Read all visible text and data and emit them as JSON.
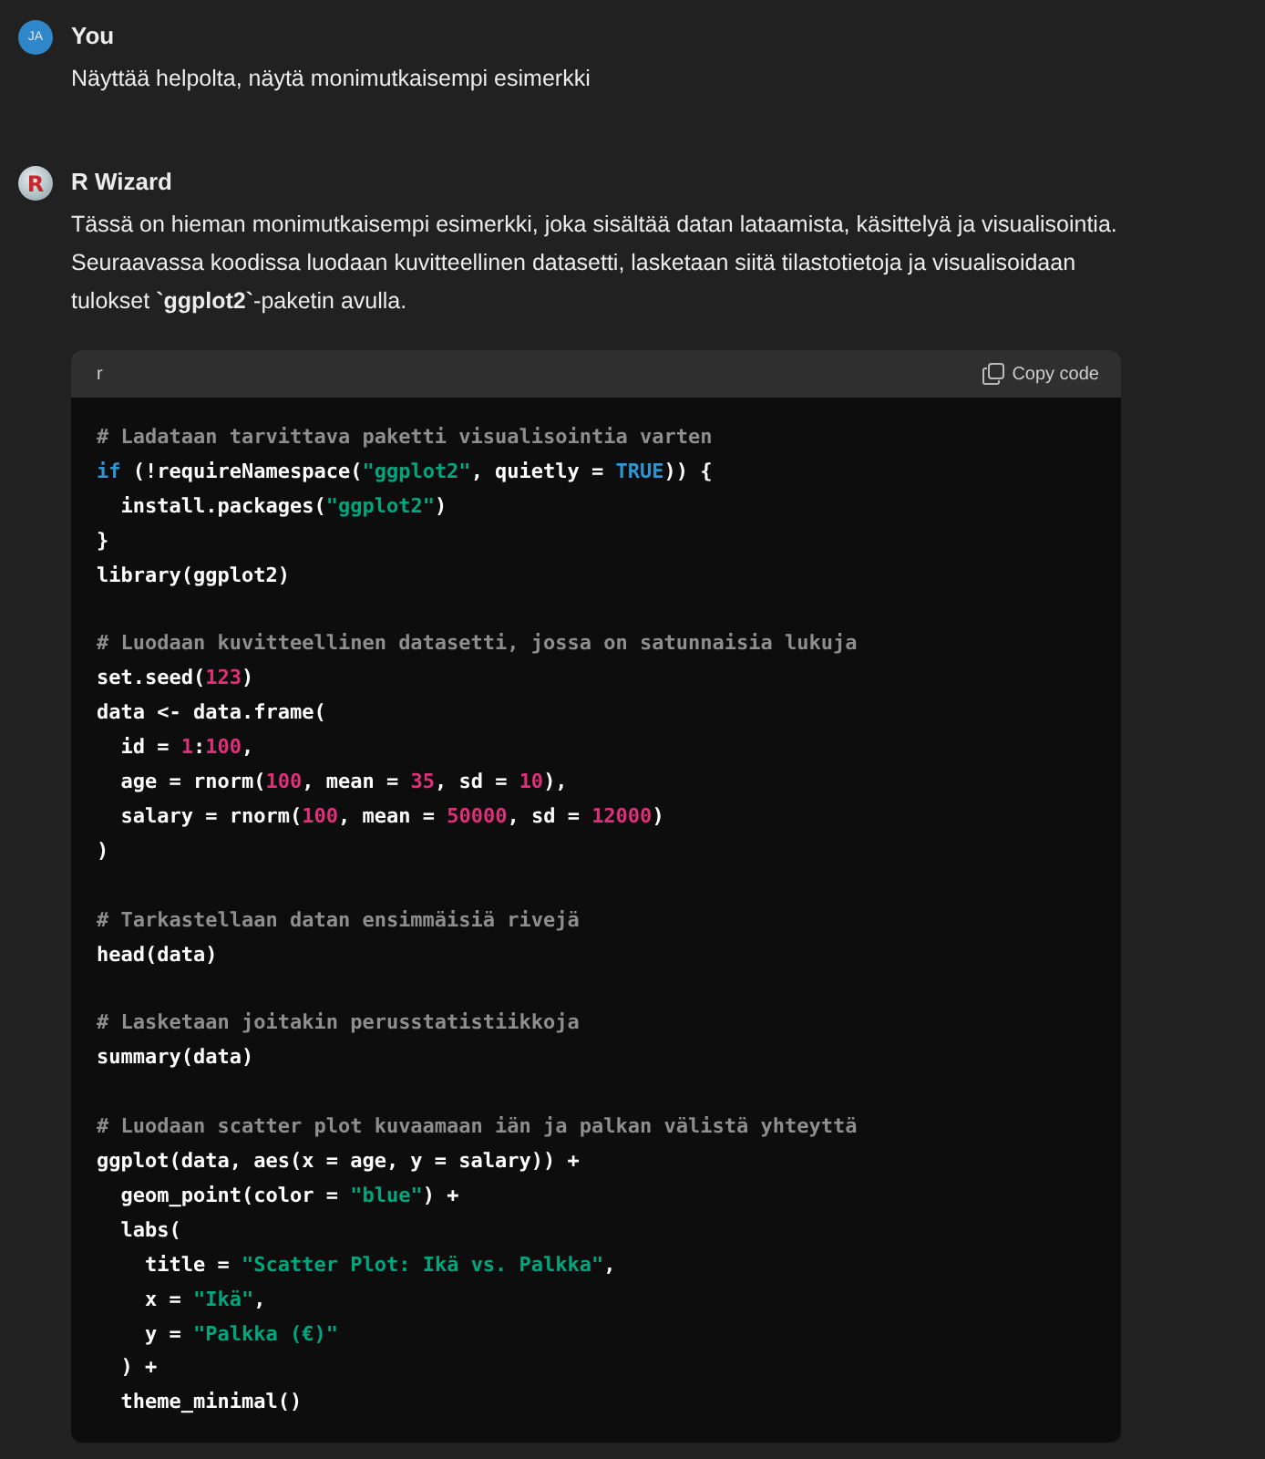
{
  "messages": [
    {
      "author": "You",
      "avatar": {
        "kind": "initials",
        "text": "JA"
      },
      "paragraphs": [
        "Näyttää helpolta, näytä monimutkaisempi esimerkki"
      ]
    },
    {
      "author": "R Wizard",
      "avatar": {
        "kind": "logo",
        "text": "R"
      },
      "paragraphs": [
        "Tässä on hieman monimutkaisempi esimerkki, joka sisältää datan lataamista, käsittelyä ja visualisointia. Seuraavassa koodissa luodaan kuvitteellinen datasetti, lasketaan siitä tilastotietoja ja visualisoidaan tulokset **`ggplot2`**-paketin avulla."
      ],
      "code": {
        "language": "r",
        "copy_label": "Copy code",
        "blocks": [
          [
            [
              {
                "text": "# Ladataan tarvittava paketti visualisointia varten",
                "kind": "comment"
              }
            ],
            [
              {
                "text": "if",
                "kind": "keyword"
              },
              {
                "text": " (!requireNamespace(",
                "kind": "plain"
              },
              {
                "text": "\"ggplot2\"",
                "kind": "string"
              },
              {
                "text": ", quietly = ",
                "kind": "plain"
              },
              {
                "text": "TRUE",
                "kind": "keyword"
              },
              {
                "text": ")) {",
                "kind": "plain"
              }
            ],
            [
              {
                "text": "  install.packages(",
                "kind": "plain"
              },
              {
                "text": "\"ggplot2\"",
                "kind": "string"
              },
              {
                "text": ")",
                "kind": "plain"
              }
            ],
            [
              {
                "text": "}",
                "kind": "plain"
              }
            ],
            [
              {
                "text": "library(ggplot2)",
                "kind": "plain"
              }
            ]
          ],
          [
            [
              {
                "text": "# Luodaan kuvitteellinen datasetti, jossa on satunnaisia lukuja",
                "kind": "comment"
              }
            ],
            [
              {
                "text": "set.seed(",
                "kind": "plain"
              },
              {
                "text": "123",
                "kind": "number"
              },
              {
                "text": ")",
                "kind": "plain"
              }
            ],
            [
              {
                "text": "data <- data.frame(",
                "kind": "plain"
              }
            ],
            [
              {
                "text": "  id = ",
                "kind": "plain"
              },
              {
                "text": "1",
                "kind": "number"
              },
              {
                "text": ":",
                "kind": "plain"
              },
              {
                "text": "100",
                "kind": "number"
              },
              {
                "text": ",",
                "kind": "plain"
              }
            ],
            [
              {
                "text": "  age = rnorm(",
                "kind": "plain"
              },
              {
                "text": "100",
                "kind": "number"
              },
              {
                "text": ", mean = ",
                "kind": "plain"
              },
              {
                "text": "35",
                "kind": "number"
              },
              {
                "text": ", sd = ",
                "kind": "plain"
              },
              {
                "text": "10",
                "kind": "number"
              },
              {
                "text": "),",
                "kind": "plain"
              }
            ],
            [
              {
                "text": "  salary = rnorm(",
                "kind": "plain"
              },
              {
                "text": "100",
                "kind": "number"
              },
              {
                "text": ", mean = ",
                "kind": "plain"
              },
              {
                "text": "50000",
                "kind": "number"
              },
              {
                "text": ", sd = ",
                "kind": "plain"
              },
              {
                "text": "12000",
                "kind": "number"
              },
              {
                "text": ")",
                "kind": "plain"
              }
            ],
            [
              {
                "text": ")",
                "kind": "plain"
              }
            ]
          ],
          [
            [
              {
                "text": "# Tarkastellaan datan ensimmäisiä rivejä",
                "kind": "comment"
              }
            ],
            [
              {
                "text": "head(data)",
                "kind": "plain"
              }
            ]
          ],
          [
            [
              {
                "text": "# Lasketaan joitakin perusstatistiikkoja",
                "kind": "comment"
              }
            ],
            [
              {
                "text": "summary(data)",
                "kind": "plain"
              }
            ]
          ],
          [
            [
              {
                "text": "# Luodaan scatter plot kuvaamaan iän ja palkan välistä yhteyttä",
                "kind": "comment"
              }
            ],
            [
              {
                "text": "ggplot(data, aes(x = age, y = salary)) +",
                "kind": "plain"
              }
            ],
            [
              {
                "text": "  geom_point(color = ",
                "kind": "plain"
              },
              {
                "text": "\"blue\"",
                "kind": "string"
              },
              {
                "text": ") +",
                "kind": "plain"
              }
            ],
            [
              {
                "text": "  labs(",
                "kind": "plain"
              }
            ],
            [
              {
                "text": "    title = ",
                "kind": "plain"
              },
              {
                "text": "\"Scatter Plot: Ikä vs. Palkka\"",
                "kind": "string"
              },
              {
                "text": ",",
                "kind": "plain"
              }
            ],
            [
              {
                "text": "    x = ",
                "kind": "plain"
              },
              {
                "text": "\"Ikä\"",
                "kind": "string"
              },
              {
                "text": ",",
                "kind": "plain"
              }
            ],
            [
              {
                "text": "    y = ",
                "kind": "plain"
              },
              {
                "text": "\"Palkka (€)\"",
                "kind": "string"
              }
            ],
            [
              {
                "text": "  ) +",
                "kind": "plain"
              }
            ],
            [
              {
                "text": "  theme_minimal()",
                "kind": "plain"
              }
            ]
          ]
        ]
      }
    }
  ]
}
